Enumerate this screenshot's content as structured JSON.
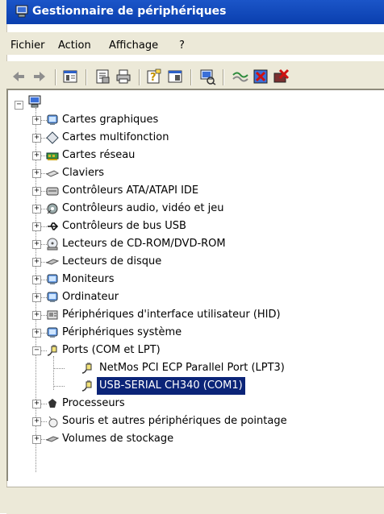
{
  "window": {
    "title": "Gestionnaire de périphériques",
    "title_color": "#ffffff",
    "titlebar_color": "#0a3fae"
  },
  "menu": [
    "Fichier",
    "Action",
    "Affichage",
    "?"
  ],
  "toolbar": {
    "icons": [
      "back-arrow-icon",
      "forward-arrow-icon",
      "console-tree-icon",
      "properties-icon",
      "print-icon",
      "help-icon",
      "show-hide-icon",
      "scan-hardware-icon",
      "update-driver-icon",
      "disable-device-icon",
      "uninstall-device-icon"
    ]
  },
  "tree": {
    "root_icon": "computer-icon",
    "categories": [
      {
        "label": "Cartes graphiques",
        "icon": "display-adapter-icon",
        "expander": "+"
      },
      {
        "label": "Cartes multifonction",
        "icon": "multifunction-icon",
        "expander": "+"
      },
      {
        "label": "Cartes réseau",
        "icon": "network-card-icon",
        "expander": "+"
      },
      {
        "label": "Claviers",
        "icon": "keyboard-icon",
        "expander": "+"
      },
      {
        "label": "Contrôleurs ATA/ATAPI IDE",
        "icon": "ide-controller-icon",
        "expander": "+"
      },
      {
        "label": "Contrôleurs audio, vidéo et jeu",
        "icon": "audio-icon",
        "expander": "+"
      },
      {
        "label": "Contrôleurs de bus USB",
        "icon": "usb-icon",
        "expander": "+"
      },
      {
        "label": "Lecteurs de CD-ROM/DVD-ROM",
        "icon": "cdrom-icon",
        "expander": "+"
      },
      {
        "label": "Lecteurs de disque",
        "icon": "disk-drive-icon",
        "expander": "+"
      },
      {
        "label": "Moniteurs",
        "icon": "monitor-icon",
        "expander": "+"
      },
      {
        "label": "Ordinateur",
        "icon": "computer-small-icon",
        "expander": "+"
      },
      {
        "label": "Périphériques d'interface utilisateur (HID)",
        "icon": "hid-icon",
        "expander": "+"
      },
      {
        "label": "Périphériques système",
        "icon": "system-device-icon",
        "expander": "+"
      },
      {
        "label": "Ports (COM et LPT)",
        "icon": "port-plug-icon",
        "expander": "−",
        "children": [
          {
            "label": "NetMos PCI ECP Parallel Port (LPT3)",
            "icon": "port-plug-icon"
          },
          {
            "label": "USB-SERIAL CH340 (COM1)",
            "icon": "port-plug-icon",
            "selected": true
          }
        ]
      },
      {
        "label": "Processeurs",
        "icon": "processor-icon",
        "expander": "+"
      },
      {
        "label": "Souris et autres périphériques de pointage",
        "icon": "mouse-icon",
        "expander": "+"
      },
      {
        "label": "Volumes de stockage",
        "icon": "storage-volume-icon",
        "expander": "+"
      }
    ]
  },
  "colors": {
    "selection_bg": "#0b2478",
    "selection_fg": "#ffffff",
    "chrome": "#ece9d8"
  }
}
